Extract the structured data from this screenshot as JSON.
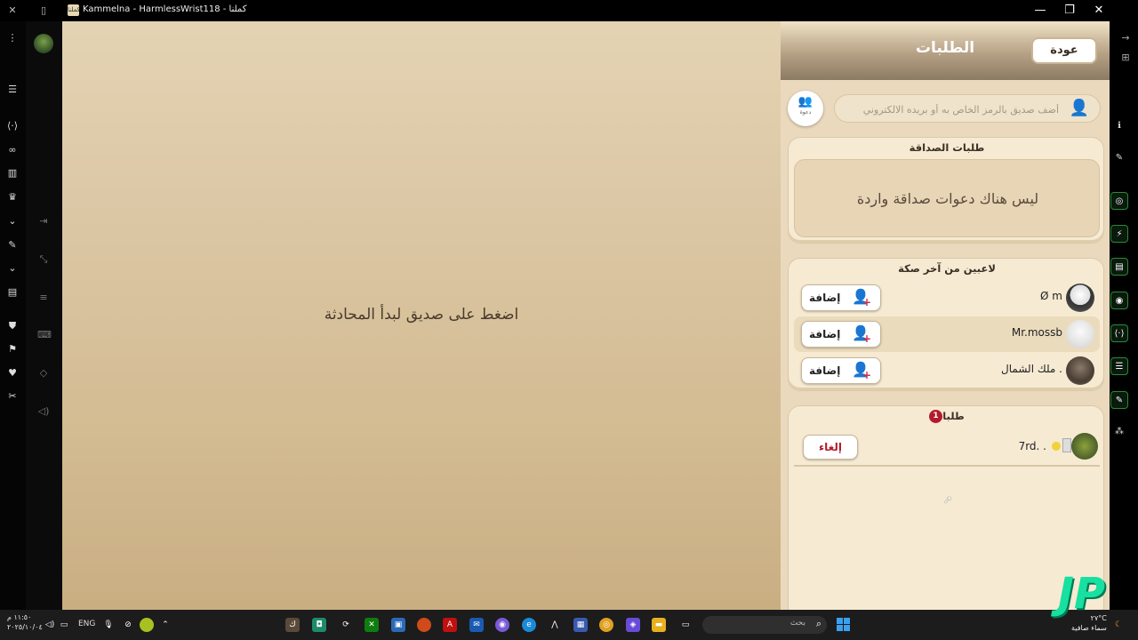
{
  "window": {
    "title": "Kammelna - HarmlessWrist118 - كملنا",
    "app_icon_text": "كملنا"
  },
  "main": {
    "hint": "اضغط على صديق لبدأ المحادثة"
  },
  "panel": {
    "title": "الطلبات",
    "back_label": "عودة",
    "invite_label": "دعوة",
    "search_placeholder": "أضف صديق بالرمز الخاص به أو بريده الالكتروني",
    "friend_requests": {
      "title": "طلبات الصداقة",
      "empty_text": "ليس هناك دعوات صداقة واردة"
    },
    "last_game_players": {
      "title": "لاعبين من آخر صكة",
      "add_label": "إضافة",
      "players": [
        {
          "name": "Ø m"
        },
        {
          "name": "Mr.mossb"
        },
        {
          "name": "ملك الشمال ."
        }
      ]
    },
    "my_requests": {
      "title": "طلباتك",
      "count": "1",
      "cancel_label": "إلغاء",
      "items": [
        {
          "name": "7rd. ."
        }
      ]
    }
  },
  "taskbar": {
    "clock_time": "١١:٥٠ م",
    "clock_date": "٢٠٢٥/١٠/٠٤",
    "language": "ENG",
    "search_placeholder": "بحث",
    "weather_temp": "٢٧°C",
    "weather_text": "سماء صافية"
  },
  "colors": {
    "panel_bg": "#ead9bd",
    "accent_red": "#b31b2c",
    "add_blue": "#3c7cc4",
    "brand_green": "#17e0a0"
  }
}
